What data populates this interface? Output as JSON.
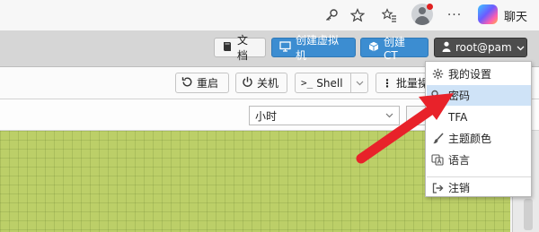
{
  "browser": {
    "copilot_label": "聊天",
    "icons": [
      "key-icon",
      "star-icon",
      "favorites-icon",
      "profile-avatar",
      "more-icon",
      "copilot-icon"
    ]
  },
  "header": {
    "docs_label": "文档",
    "create_vm_label": "创建虚拟机",
    "create_ct_label": "创建 CT",
    "user_label": "root@pam"
  },
  "toolbar": {
    "reboot_label": "重启",
    "shutdown_label": "关机",
    "shell_label": "Shell",
    "bulk_label": "批量操"
  },
  "filter": {
    "timeframe_value": "小时"
  },
  "user_menu": {
    "items": [
      {
        "label": "我的设置",
        "icon": "gear-icon"
      },
      {
        "label": "密码",
        "icon": "key-icon"
      },
      {
        "label": "TFA",
        "icon": "lock-icon"
      },
      {
        "label": "主题颜色",
        "icon": "paintbrush-icon"
      },
      {
        "label": "语言",
        "icon": "language-icon"
      },
      {
        "label": "注销",
        "icon": "logout-icon"
      }
    ],
    "highlighted": "密码"
  },
  "colors": {
    "accent_blue": "#3c8dd1",
    "user_button": "#4d4d4d",
    "graph_bg": "#bccf68",
    "menu_highlight": "#cfe3f7",
    "annotation_arrow": "#e8222a"
  }
}
